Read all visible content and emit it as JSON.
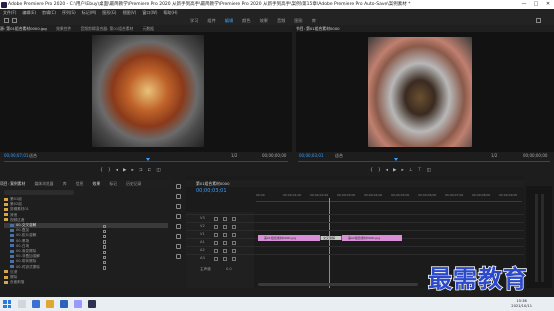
{
  "titlebar": {
    "title": "Adobe Premiere Pro 2020 - C:\\用户\\Ebuy\\桌面\\最简教学\\Premiere Pro 2020 从新手到高手\\最简教学\\Premiere Pro 2020 从新手到高手\\案例\\第15章\\Adobe Premiere Pro Auto-Save\\案例素材 *",
    "controls": [
      "—",
      "□",
      "✕"
    ]
  },
  "menu": [
    "文件(F)",
    "编辑(E)",
    "剪辑(C)",
    "序列(S)",
    "标记(M)",
    "图形(G)",
    "视图(V)",
    "窗口(W)",
    "帮助(H)"
  ],
  "workspaces": {
    "tabs": [
      "学习",
      "组件",
      "编辑",
      "颜色",
      "效果",
      "音频",
      "图形",
      "库"
    ],
    "active_index": 2
  },
  "source_panel": {
    "tabs": [
      "源: 第01组合素材0000.jpg",
      "效果控件",
      "音频剪辑混合器: 第01组合素材",
      "元数据"
    ],
    "timecode_left": "00;00;07;01",
    "fit": "适合",
    "ratio": "1/2",
    "timecode_right": "00;00;00;00"
  },
  "program_panel": {
    "tabs": [
      "节目: 第01组合素材0000"
    ],
    "timecode_left": "00;00;03;01",
    "fit": "适合",
    "ratio": "1/2",
    "timecode_right": "00;00;00;00"
  },
  "project_panel": {
    "tabs": [
      "项目: 案例素材",
      "媒体浏览器",
      "库",
      "信息",
      "效果",
      "标记",
      "历史记录"
    ],
    "rows": [
      {
        "label": "第01组",
        "indent": 0,
        "type": "folder",
        "selected": false
      },
      {
        "label": "第02组",
        "indent": 0,
        "type": "folder",
        "selected": false
      },
      {
        "label": "剪辑素材01",
        "indent": 0,
        "type": "folder",
        "selected": false
      },
      {
        "label": "其他",
        "indent": 0,
        "type": "folder",
        "selected": false
      },
      {
        "label": "视频过渡",
        "indent": 0,
        "type": "folder",
        "selected": false
      },
      {
        "label": "00-交叉溶解",
        "indent": 1,
        "type": "item",
        "selected": true
      },
      {
        "label": "00-叠加",
        "indent": 1,
        "type": "item",
        "selected": false
      },
      {
        "label": "00-胶片溶解",
        "indent": 1,
        "type": "item",
        "selected": false
      },
      {
        "label": "00-黑场",
        "indent": 1,
        "type": "item",
        "selected": false
      },
      {
        "label": "00-白场",
        "indent": 1,
        "type": "item",
        "selected": false
      },
      {
        "label": "00-渐变擦除",
        "indent": 1,
        "type": "item",
        "selected": false
      },
      {
        "label": "00-非叠加溶解",
        "indent": 1,
        "type": "item",
        "selected": false
      },
      {
        "label": "00-带状擦除",
        "indent": 1,
        "type": "item",
        "selected": false
      },
      {
        "label": "00-时钟式擦除",
        "indent": 1,
        "type": "item",
        "selected": false
      },
      {
        "label": "沉浸",
        "indent": 0,
        "type": "folder",
        "selected": false
      },
      {
        "label": "擦除",
        "indent": 0,
        "type": "folder",
        "selected": false
      },
      {
        "label": "页面剥落",
        "indent": 0,
        "type": "folder",
        "selected": false
      }
    ]
  },
  "timeline": {
    "tab": "第01组合素材0000",
    "timecode": "00;00;03;01",
    "ruler_labels": [
      "00;00",
      "00;00;01;00",
      "00;00;02;00",
      "00;00;03;00",
      "00;00;04;00",
      "00;00;05;00",
      "00;00;06;00",
      "00;00;07;00",
      "00;00;08;00",
      "00;00;09;00"
    ],
    "tracks": [
      {
        "name": "V3"
      },
      {
        "name": "V2"
      },
      {
        "name": "V1"
      },
      {
        "name": "A1"
      },
      {
        "name": "A2"
      },
      {
        "name": "A3"
      }
    ],
    "master": "主声道",
    "master_value": "0.0",
    "clips": [
      {
        "label": "第01组合素材0000.jpg",
        "color": "#d98fd6"
      },
      {
        "label": "交叉溶解",
        "color": "#c8c8c8"
      },
      {
        "label": "第02组合素材0000.jpg",
        "color": "#d98fd6"
      }
    ]
  },
  "taskbar": {
    "time": "15:36",
    "date": "2021/10/11"
  },
  "watermark": "最需教育"
}
